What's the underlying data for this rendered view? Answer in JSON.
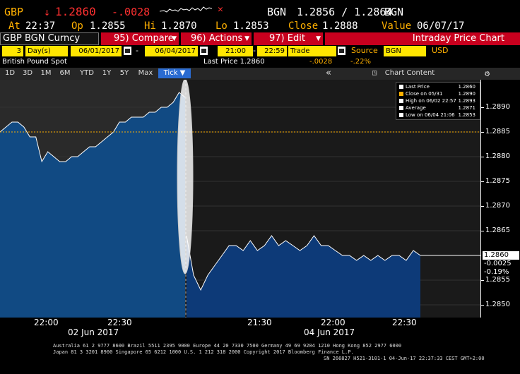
{
  "quote": {
    "ticker": "GBP",
    "arrow": "↓",
    "price": "1.2860",
    "change": "-.0028",
    "source_label": "BGN",
    "bid_ask": "1.2856 / 1.2864",
    "source_label2": "BGN"
  },
  "stats": {
    "at_label": "At",
    "at_value": "22:37",
    "op_label": "Op",
    "op_value": "1.2855",
    "hi_label": "Hi",
    "hi_value": "1.2870",
    "lo_label": "Lo",
    "lo_value": "1.2853",
    "close_label": "Close",
    "close_value": "1.2888",
    "value_label": "Value",
    "value_value": "06/07/17"
  },
  "menubar": {
    "security": "GBP BGN Curncy",
    "compare": "95) Compare",
    "actions": "96) Actions",
    "edit": "97) Edit",
    "title": "Intraday Price Chart"
  },
  "params": {
    "period_num": "3",
    "period_unit": "Day(s)",
    "start_date": "06/01/2017",
    "dash": "-",
    "end_date": "06/04/2017",
    "start_time": "21:00",
    "end_time": "22:59",
    "field": "Trade",
    "source_label": "Source",
    "source_value": "BGN",
    "currency": "USD"
  },
  "info": {
    "name": "British Pound Spot",
    "last_price_label": "Last Price 1.2860",
    "change_abs": "-.0028",
    "change_pct": "-.22%"
  },
  "toolbar": {
    "ranges": [
      "1D",
      "3D",
      "1M",
      "6M",
      "YTD",
      "1Y",
      "5Y",
      "Max"
    ],
    "tick": "Tick ▼",
    "chart_content": "Chart Content",
    "collapse": "«"
  },
  "legend": {
    "items": [
      {
        "label": "Last Price",
        "value": "1.2860",
        "color": "#ffffff"
      },
      {
        "label": "Close on 05/31",
        "value": "1.2890",
        "color": "#ffb000"
      },
      {
        "label": "High on 06/02 22:57",
        "value": "1.2893",
        "color": "#ffffff"
      },
      {
        "label": "Average",
        "value": "1.2871",
        "color": "#ffffff"
      },
      {
        "label": "Low on 06/04 21:06",
        "value": "1.2853",
        "color": "#ffffff"
      }
    ]
  },
  "yaxis": {
    "ticks": [
      "1.2890",
      "1.2885",
      "1.2880",
      "1.2875",
      "1.2870",
      "1.2865",
      "1.2855",
      "1.2850"
    ],
    "last_box": "1.2860",
    "chg_box": "-0.0025",
    "pct_box": "-0.19%"
  },
  "xaxis": {
    "t1": "22:00",
    "t2": "22:30",
    "d1": "02 Jun 2017",
    "t3": "21:30",
    "t4": "22:00",
    "t5": "22:30",
    "d2": "04 Jun 2017"
  },
  "footer": {
    "line1": "Australia 61 2 9777 8600 Brazil 5511 2395 9000 Europe 44 20 7330 7500 Germany 49 69 9204 1210 Hong Kong 852 2977 6000",
    "line2": "Japan 81 3 3201 8900        Singapore 65 6212 1000        U.S. 1 212 318 2000              Copyright 2017 Bloomberg Finance L.P.",
    "line3": "SN 266827 H521-3101-1 04-Jun-17 22:37:33 CEST GMT+2:00"
  },
  "chart_data": {
    "type": "area",
    "ylim": [
      1.2848,
      1.2895
    ],
    "y_ticks": [
      1.285,
      1.2855,
      1.2865,
      1.287,
      1.2875,
      1.288,
      1.2885,
      1.289
    ],
    "x_tick_labels": [
      "22:00",
      "22:30",
      "21:30",
      "22:00",
      "22:30"
    ],
    "date_labels": [
      "02 Jun 2017",
      "04 Jun 2017"
    ],
    "reference_line_value": 1.2885,
    "last_price_line_value": 1.286,
    "series": [
      {
        "name": "Last Price",
        "segment": "02 Jun 2017",
        "values": [
          1.2885,
          1.2886,
          1.2887,
          1.2887,
          1.2886,
          1.2884,
          1.2884,
          1.2879,
          1.2881,
          1.288,
          1.2879,
          1.2879,
          1.288,
          1.288,
          1.2881,
          1.2882,
          1.2882,
          1.2883,
          1.2884,
          1.2885,
          1.2887,
          1.2887,
          1.2888,
          1.2888,
          1.2888,
          1.2889,
          1.2889,
          1.289,
          1.289,
          1.2891,
          1.2893,
          1.2892
        ]
      },
      {
        "name": "Last Price",
        "segment": "04 Jun 2017",
        "values": [
          1.2864,
          1.2856,
          1.2853,
          1.2856,
          1.2858,
          1.286,
          1.2862,
          1.2862,
          1.2861,
          1.2863,
          1.2861,
          1.2862,
          1.2864,
          1.2862,
          1.2863,
          1.2862,
          1.2861,
          1.2862,
          1.2864,
          1.2862,
          1.2862,
          1.2861,
          1.286,
          1.286,
          1.2859,
          1.286,
          1.2859,
          1.286,
          1.2859,
          1.286,
          1.286,
          1.2859,
          1.2861,
          1.286
        ]
      }
    ]
  }
}
